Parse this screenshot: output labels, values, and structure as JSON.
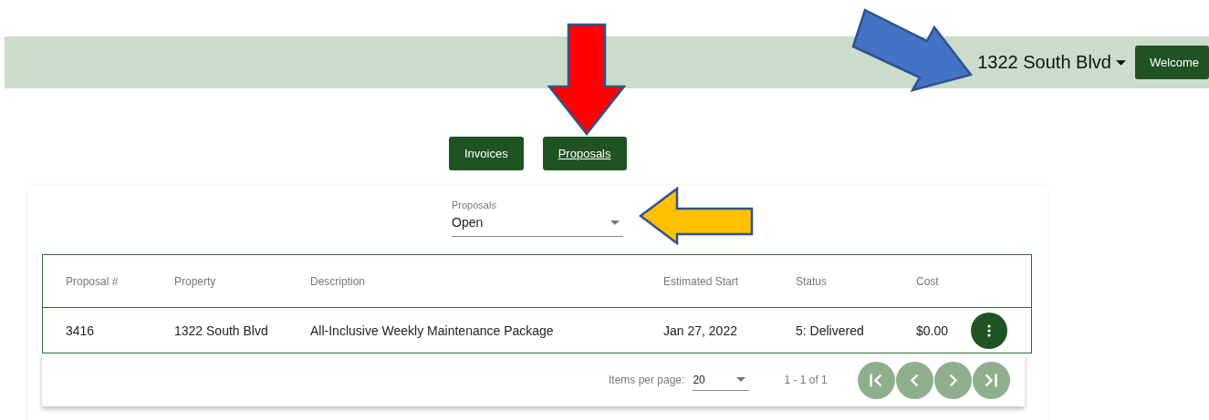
{
  "header": {
    "property_menu": "1322 South Blvd",
    "welcome_button": "Welcome"
  },
  "nav_buttons": [
    {
      "label": "Invoices",
      "selected": false
    },
    {
      "label": "Proposals",
      "selected": true
    }
  ],
  "filter": {
    "label": "Proposals",
    "value": "Open"
  },
  "table": {
    "columns": [
      "Proposal #",
      "Property",
      "Description",
      "Estimated Start",
      "Status",
      "Cost"
    ],
    "rows": [
      {
        "cells": [
          "3416",
          "1322 South Blvd",
          "All-Inclusive Weekly Maintenance Package",
          "Jan 27, 2022",
          "5: Delivered",
          "$0.00"
        ]
      }
    ]
  },
  "paginator": {
    "items_label": "Items per page:",
    "page_size": "20",
    "range": "1 - 1 of 1",
    "buttons": [
      {
        "kind": "first",
        "disabled": true
      },
      {
        "kind": "previous",
        "disabled": true
      },
      {
        "kind": "next",
        "disabled": true
      },
      {
        "kind": "last",
        "disabled": true
      }
    ]
  }
}
